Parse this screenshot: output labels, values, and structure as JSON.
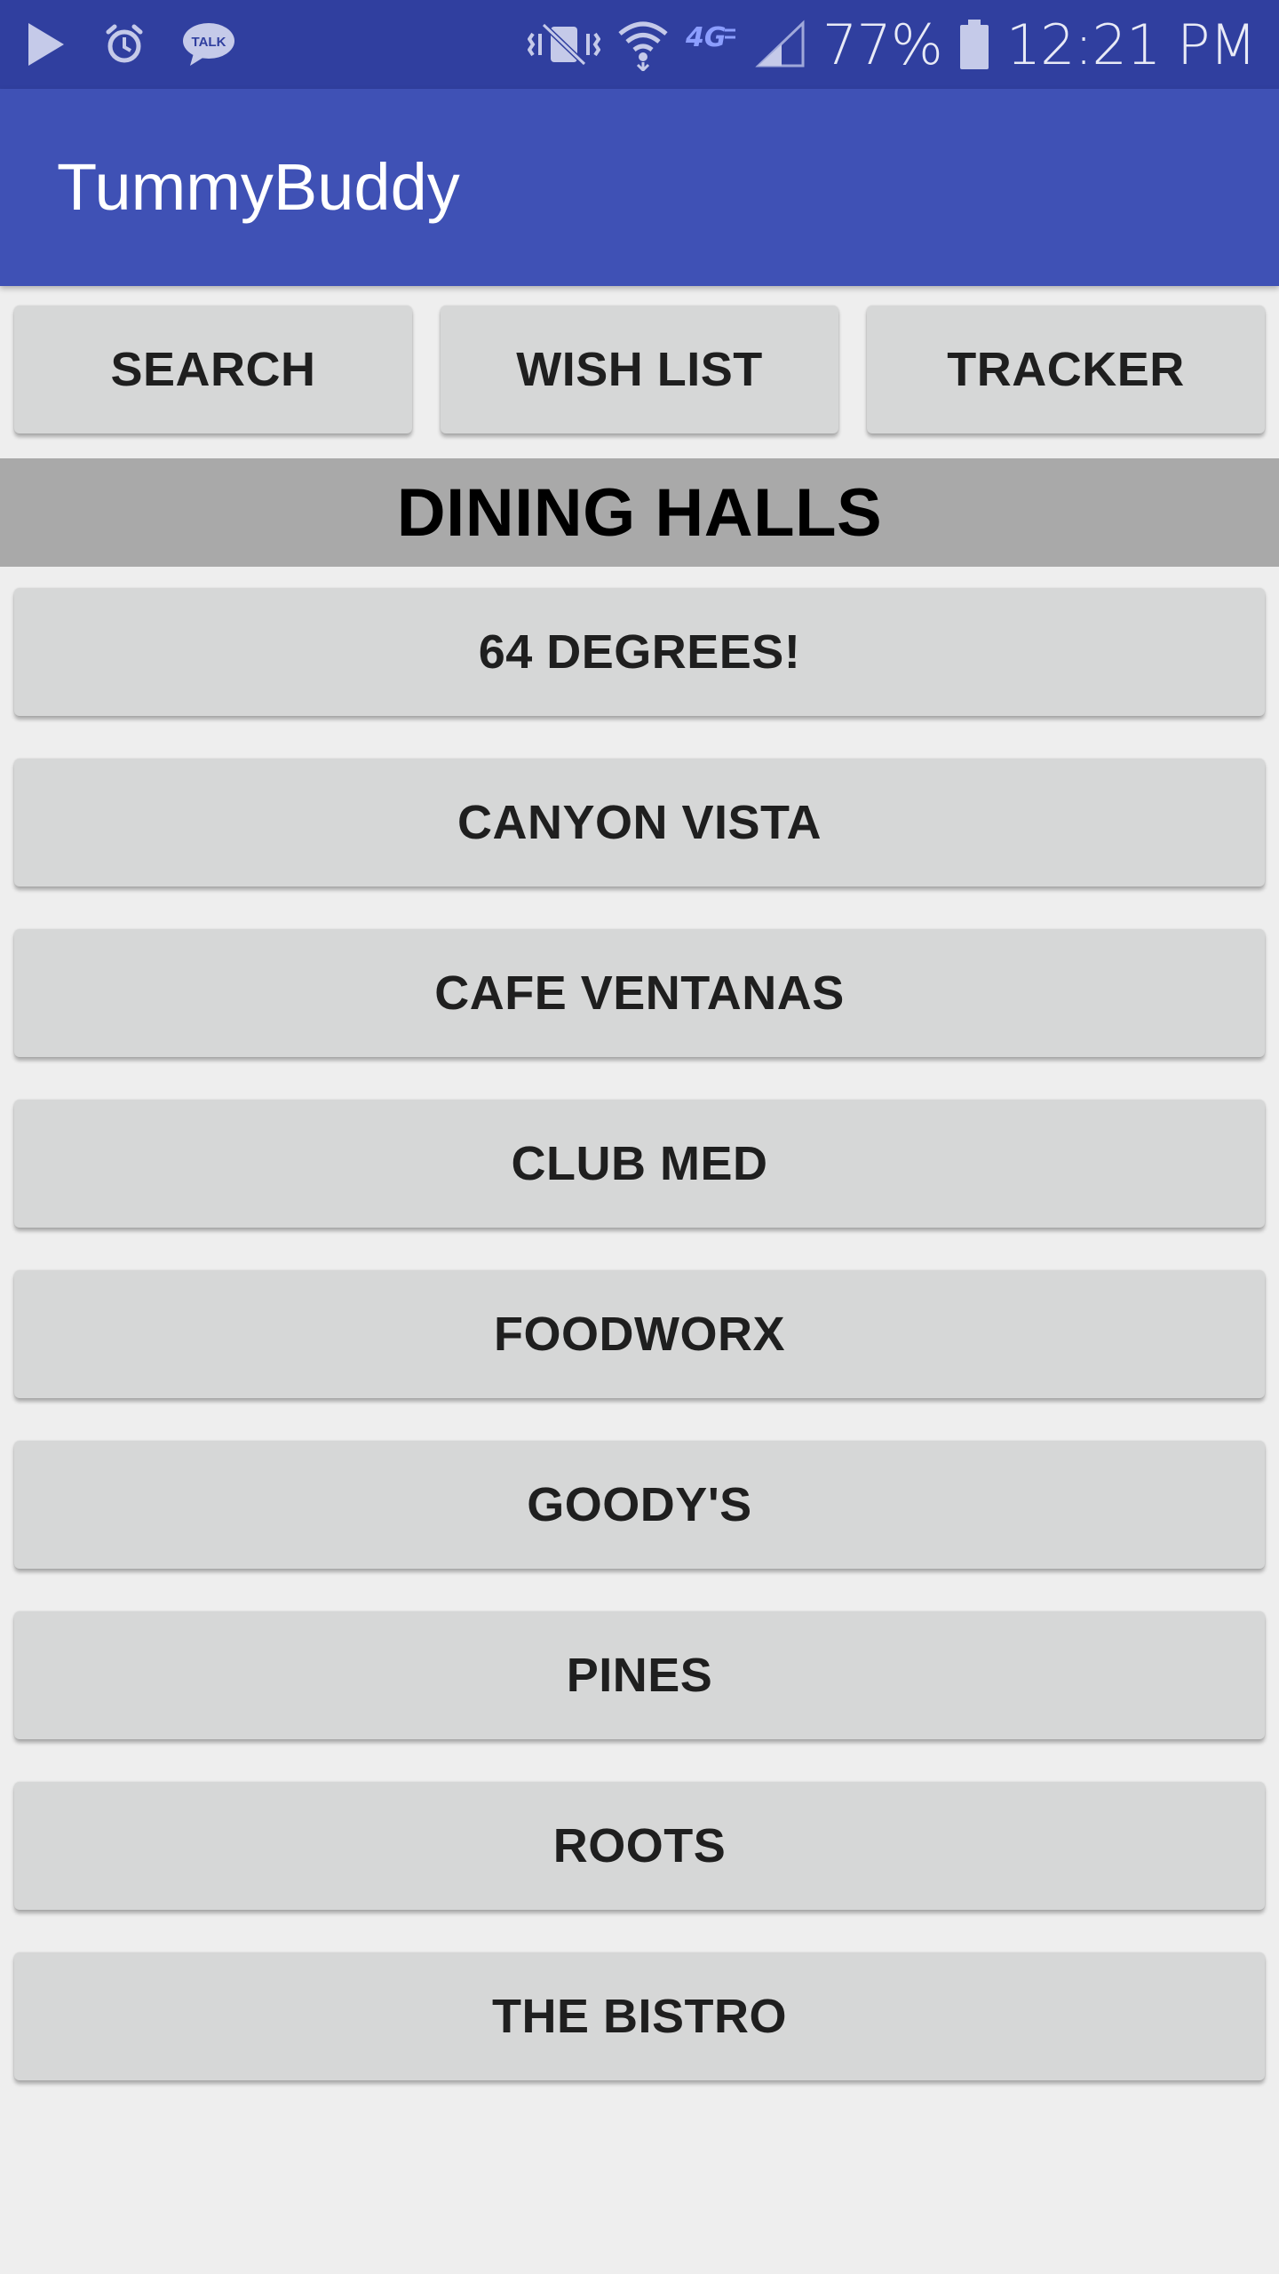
{
  "status_bar": {
    "icons_left": [
      "play-icon",
      "alarm-icon",
      "talk-icon"
    ],
    "icons_right": [
      "vibrate-icon",
      "wifi-icon",
      "network-4g-icon",
      "signal-icon"
    ],
    "battery_percent": "77%",
    "time": "12:21 PM",
    "talk_badge": "TALK",
    "network_label": "4G"
  },
  "app_bar": {
    "title": "TummyBuddy"
  },
  "toolbar": {
    "search_label": "SEARCH",
    "wishlist_label": "WISH LIST",
    "tracker_label": "TRACKER"
  },
  "section": {
    "title": "DINING HALLS"
  },
  "dining_halls": [
    {
      "label": "64 DEGREES!"
    },
    {
      "label": "CANYON VISTA"
    },
    {
      "label": "CAFE VENTANAS"
    },
    {
      "label": "CLUB MED"
    },
    {
      "label": "FOODWORX"
    },
    {
      "label": "GOODY'S"
    },
    {
      "label": "PINES"
    },
    {
      "label": "ROOTS"
    },
    {
      "label": "THE BISTRO"
    }
  ],
  "colors": {
    "status_bar": "#303f9f",
    "app_bar": "#3f51b5",
    "button_bg": "#d6d7d7",
    "section_header_bg": "#a9a9a9",
    "page_bg": "#eeeeee"
  }
}
